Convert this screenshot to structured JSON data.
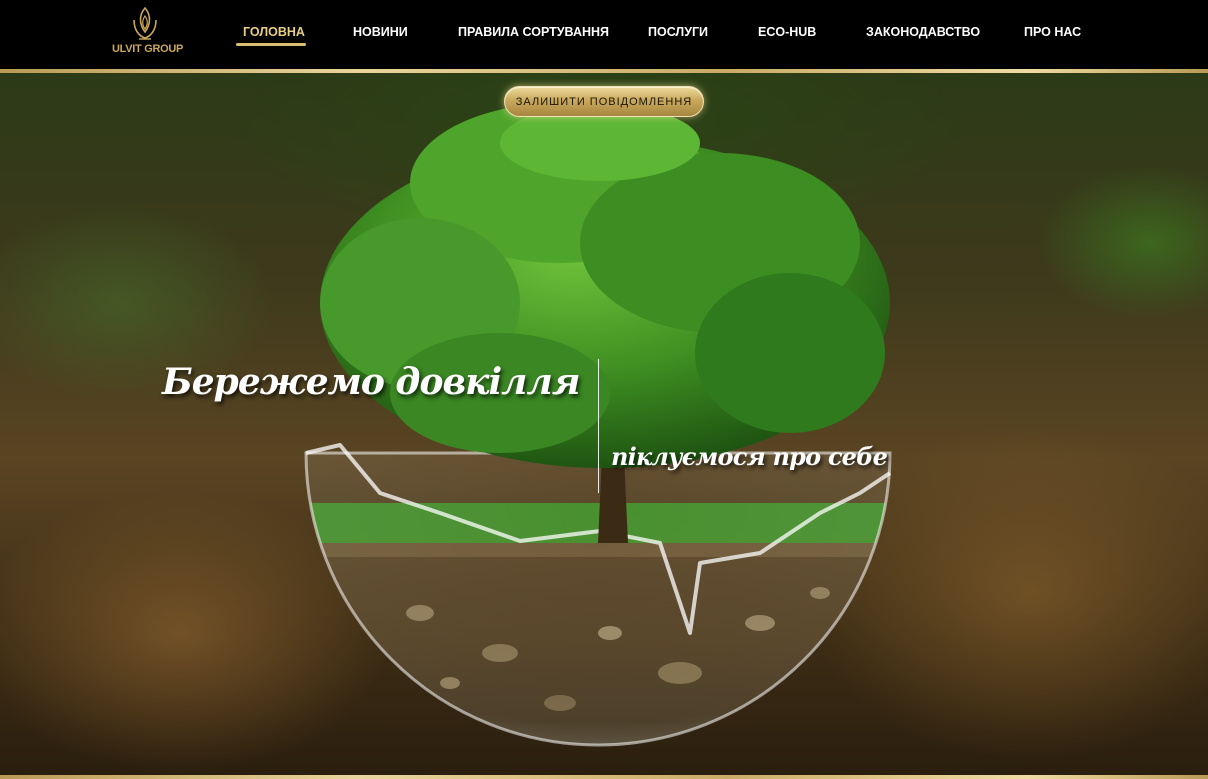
{
  "brand": {
    "logo_text": "ULVIT GROUP"
  },
  "nav": {
    "items": [
      {
        "label": "ГОЛОВНА",
        "active": true
      },
      {
        "label": "НОВИНИ",
        "active": false
      },
      {
        "label": "ПРАВИЛА СОРТУВАННЯ",
        "active": false
      },
      {
        "label": "ПОСЛУГИ",
        "active": false
      },
      {
        "label": "ECO-HUB",
        "active": false
      },
      {
        "label": "ЗАКОНОДАВСТВО",
        "active": false
      },
      {
        "label": "ПРО НАС",
        "active": false
      }
    ]
  },
  "hero": {
    "cta_label": "ЗАЛИШИТИ ПОВІДОМЛЕННЯ",
    "headline": "Бережемо довкілля",
    "subheadline": "піклуємося про себе",
    "image": "tree-in-glass-sphere"
  },
  "colors": {
    "header_bg": "#000000",
    "gold_accent": "#d9bd72",
    "nav_text": "#ffffff",
    "nav_active_text": "#e9cf85"
  }
}
